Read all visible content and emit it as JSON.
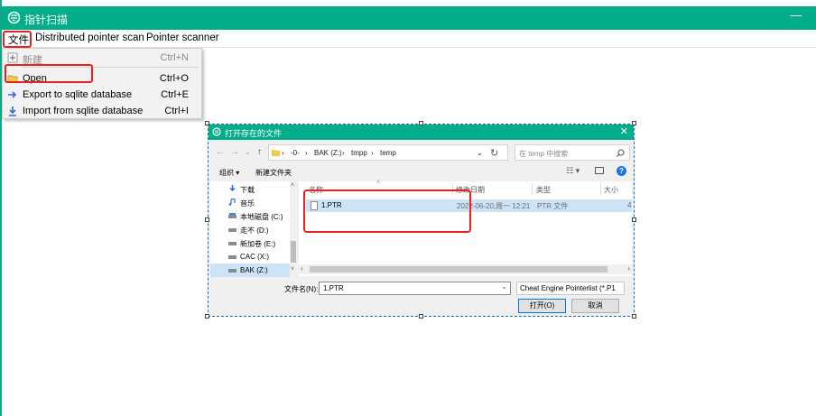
{
  "app": {
    "title": "指针扫描"
  },
  "menubar": {
    "items": [
      "文件",
      "Distributed pointer scan",
      "Pointer scanner"
    ]
  },
  "file_menu": {
    "items": [
      {
        "label": "新建",
        "shortcut": "Ctrl+N"
      },
      {
        "label": "Open",
        "shortcut": "Ctrl+O"
      },
      {
        "label": "Export to sqlite database",
        "shortcut": "Ctrl+E"
      },
      {
        "label": "Import from sqlite database",
        "shortcut": "Ctrl+I"
      }
    ]
  },
  "dialog": {
    "title": "打开存在的文件",
    "breadcrumb": [
      "-0-",
      "BAK (Z:)",
      "tmpp",
      "temp"
    ],
    "search_placeholder": "在 temp 中搜索",
    "organize": "组织 ▾",
    "new_folder": "新建文件夹",
    "nav_items": [
      {
        "label": "下载",
        "icon": "download-icon"
      },
      {
        "label": "音乐",
        "icon": "music-icon"
      },
      {
        "label": "本地磁盘 (C:)",
        "icon": "drive-icon"
      },
      {
        "label": "走不 (D:)",
        "icon": "drive-icon"
      },
      {
        "label": "新加卷 (E:)",
        "icon": "drive-icon"
      },
      {
        "label": "CAC (X:)",
        "icon": "drive-icon"
      },
      {
        "label": "BAK (Z:)",
        "icon": "drive-icon"
      }
    ],
    "columns": [
      "名称",
      "修改日期",
      "类型",
      "大小"
    ],
    "files": [
      {
        "name": "1.PTR",
        "modified": "2022-06-20,周一 12:21",
        "type": "PTR 文件",
        "size": "4"
      }
    ],
    "filename_label": "文件名(N):",
    "filename_value": "1.PTR",
    "filetype": "Cheat Engine Pointerlist (*.P1",
    "open_button": "打开(O)",
    "cancel_button": "取消"
  },
  "colors": {
    "accent": "#02ad8a",
    "highlight": "#e82222",
    "selection": "#cde3f7"
  }
}
